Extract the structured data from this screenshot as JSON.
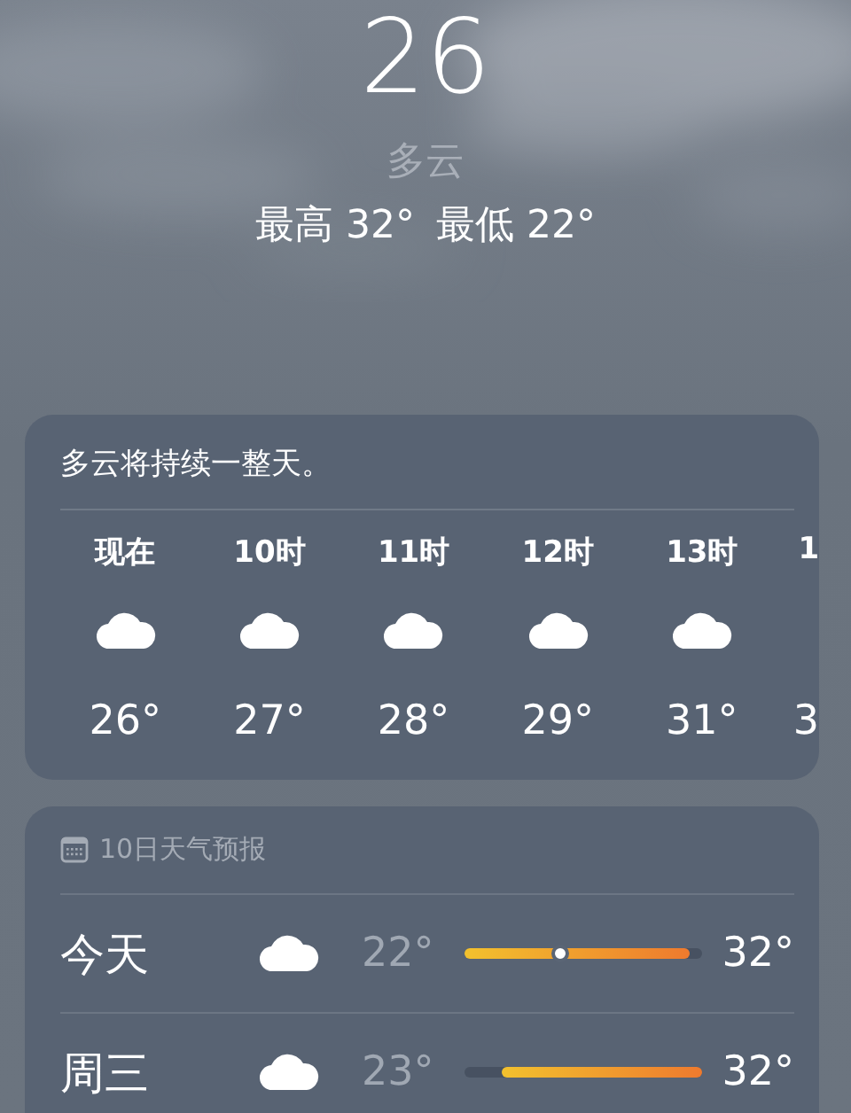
{
  "current": {
    "temperature": "26",
    "condition": "多云",
    "high": "最高 32°",
    "low": "最低 22°"
  },
  "hourly": {
    "summary": "多云将持续一整天。",
    "hours": [
      {
        "time": "现在",
        "temp": "26°",
        "kind": "full"
      },
      {
        "time": "10时",
        "temp": "27°",
        "kind": "full"
      },
      {
        "time": "11时",
        "temp": "28°",
        "kind": "full"
      },
      {
        "time": "12时",
        "temp": "29°",
        "kind": "full"
      },
      {
        "time": "13时",
        "temp": "31°",
        "kind": "full"
      },
      {
        "time": "1",
        "temp": "3",
        "kind": "partial"
      }
    ]
  },
  "daily": {
    "title": "10日天气预报",
    "days": [
      {
        "day": "今天",
        "low": "22°",
        "high": "32°",
        "bar": {
          "reaches_min": true,
          "fill": {
            "level": 0.95
          },
          "marker": {
            "level": 0.4
          }
        }
      },
      {
        "day": "周三",
        "low": "23°",
        "high": "32°",
        "bar": {
          "reaches_min": false,
          "fill": {
            "level": 0.84
          }
        }
      }
    ]
  }
}
